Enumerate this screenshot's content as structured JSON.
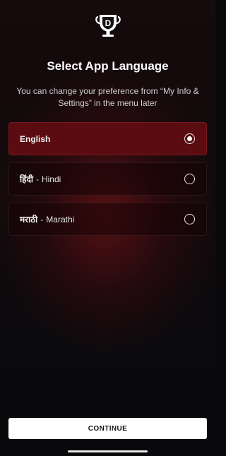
{
  "header": {
    "logo_icon": "dream11-trophy-logo-icon",
    "logo_letter": "D",
    "title": "Select App Language",
    "subtitle": "You can change your preference from “My Info & Settings” in the menu later"
  },
  "languages": [
    {
      "native": "English",
      "separator": "",
      "english": "",
      "selected": true
    },
    {
      "native": "हिंदी",
      "separator": "-",
      "english": "Hindi",
      "selected": false
    },
    {
      "native": "मराठी",
      "separator": "-",
      "english": "Marathi",
      "selected": false
    }
  ],
  "footer": {
    "continue_label": "CONTINUE"
  },
  "colors": {
    "selected_bg": "#5a0c10",
    "button_bg": "#ffffff",
    "background": "#0a0a0c"
  }
}
